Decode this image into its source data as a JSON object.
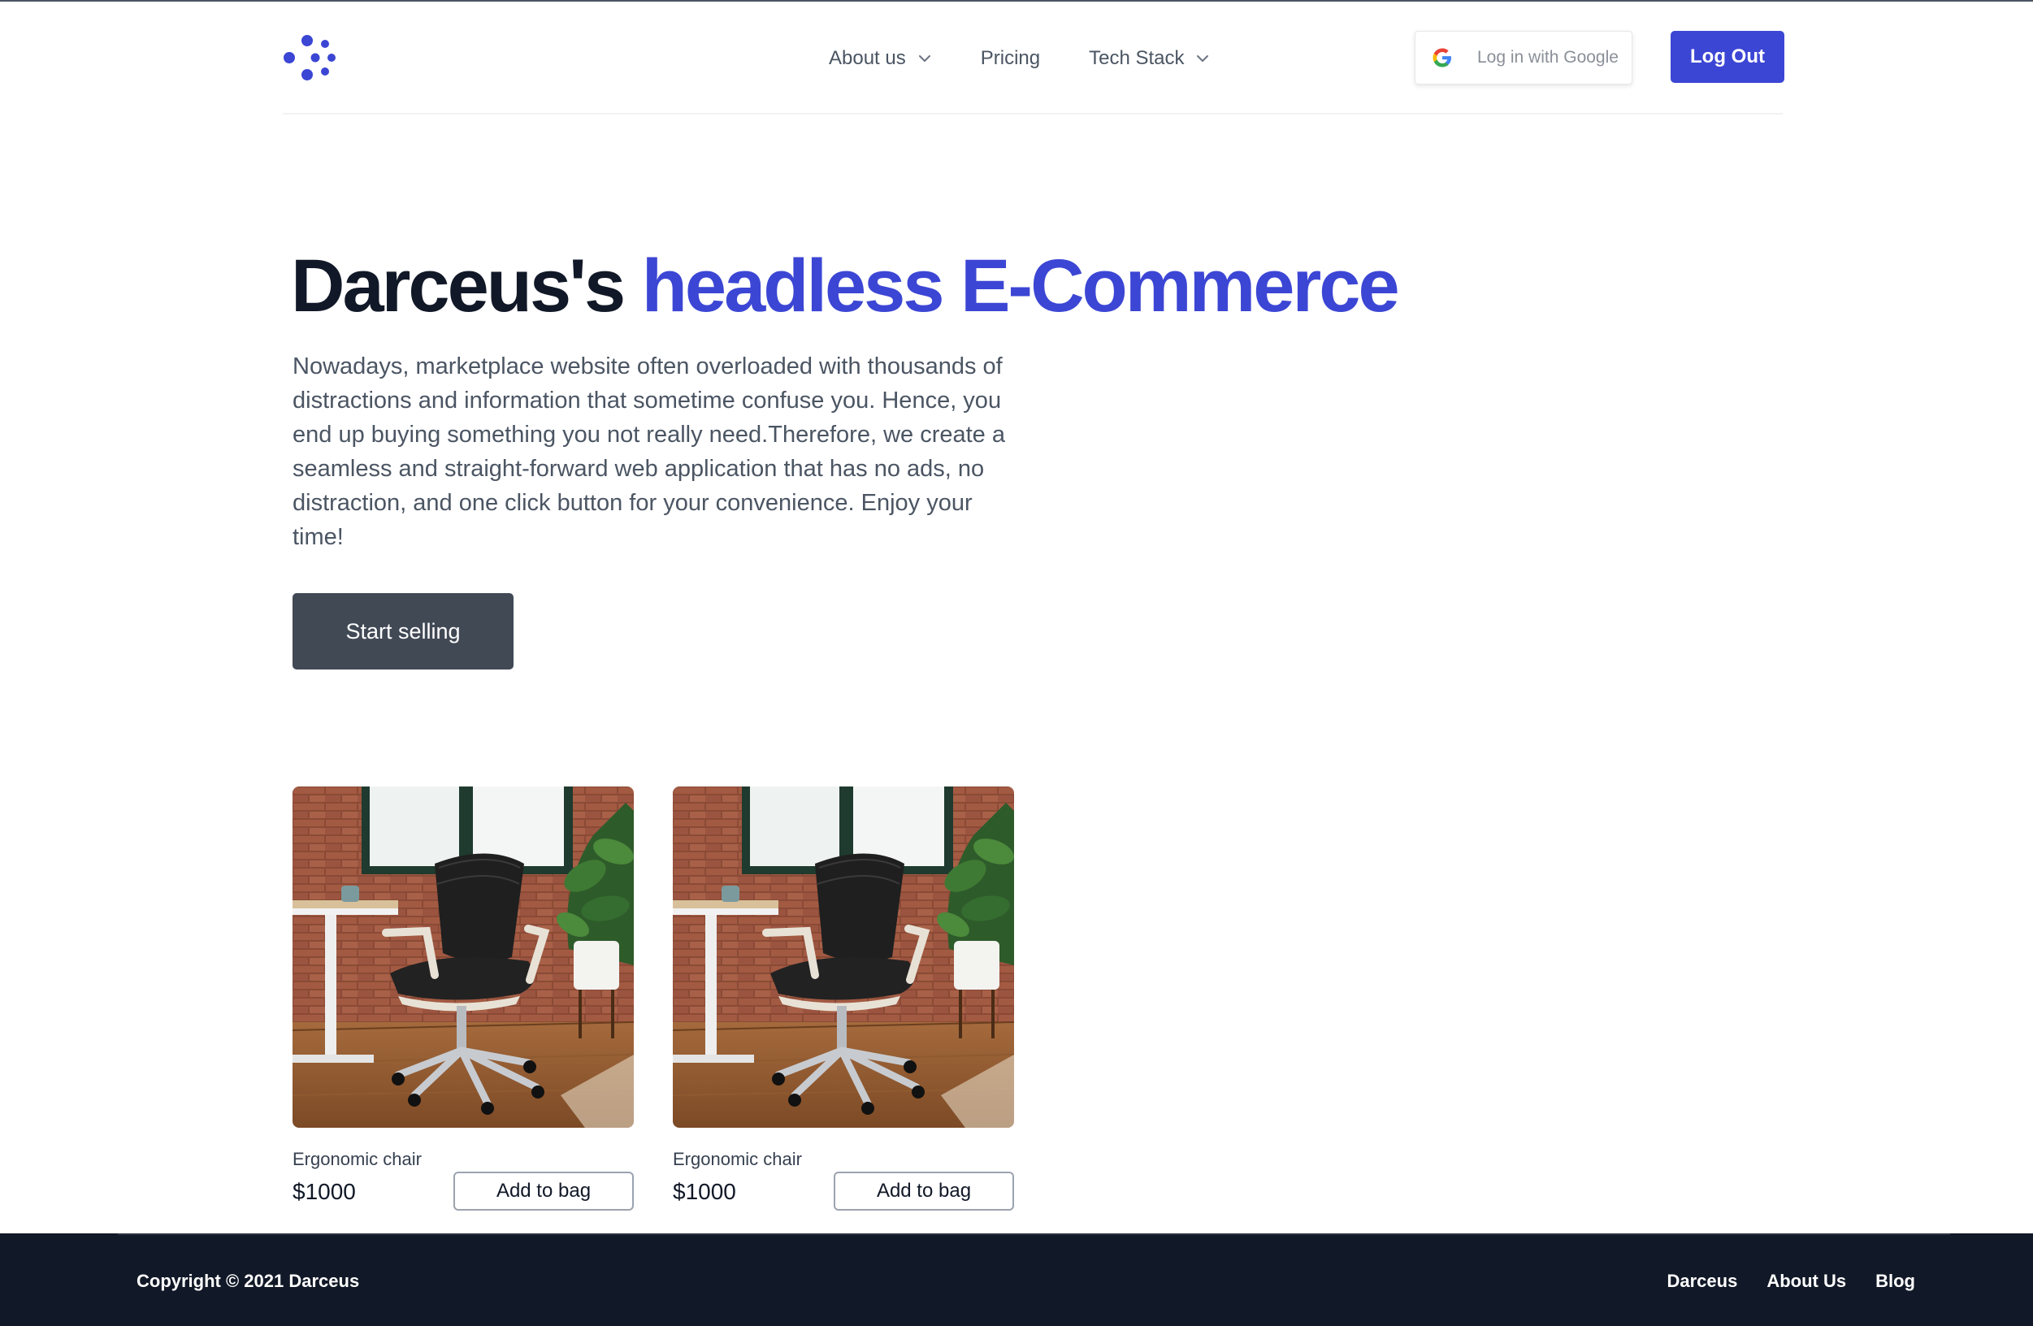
{
  "brand": {
    "accent": "#3c46d4",
    "dark_button": "#414955",
    "footer_bg": "#111827"
  },
  "header": {
    "logo_icon": "darceus-dots-logo-icon",
    "nav": [
      {
        "label": "About us",
        "dropdown": true
      },
      {
        "label": "Pricing",
        "dropdown": false
      },
      {
        "label": "Tech Stack",
        "dropdown": true
      }
    ],
    "google_login": {
      "label": "Log in with Google",
      "icon": "google-icon"
    },
    "logout_label": "Log Out"
  },
  "hero": {
    "title_plain": "Darceus's",
    "title_accent": "headless E-Commerce",
    "description": "Nowadays, marketplace website often overloaded with thousands of distractions and information that sometime confuse you. Hence, you end up buying something you not really need.Therefore, we create a seamless and straight-forward web application that has no ads, no distraction, and one click button for your convenience. Enjoy your time!",
    "cta_label": "Start selling"
  },
  "products": [
    {
      "name": "Ergonomic chair",
      "price": "$1000",
      "button": "Add to bag",
      "image": "office-chair-photo"
    },
    {
      "name": "Ergonomic chair",
      "price": "$1000",
      "button": "Add to bag",
      "image": "office-chair-photo"
    }
  ],
  "footer": {
    "copyright": "Copyright © 2021 Darceus",
    "links": [
      "Darceus",
      "About Us",
      "Blog"
    ]
  }
}
